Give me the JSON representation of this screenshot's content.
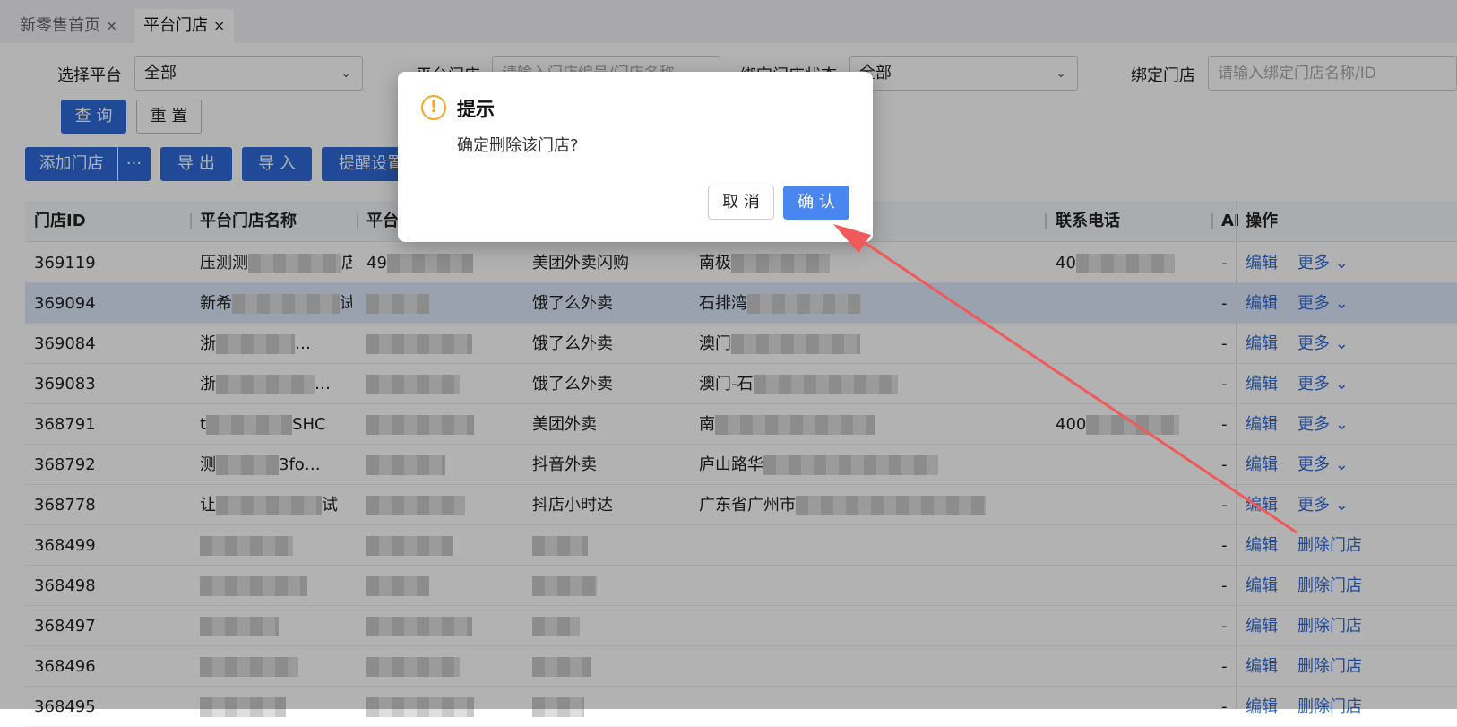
{
  "tabs": [
    {
      "label": "新零售首页",
      "close": "×"
    },
    {
      "label": "平台门店",
      "close": "×"
    }
  ],
  "filters": {
    "platform_label": "选择平台",
    "platform_value": "全部",
    "store_label": "平台门店",
    "store_placeholder": "请输入门店编号/门店名称",
    "bind_status_label": "绑定门店状态",
    "bind_status_value": "全部",
    "bind_store_label": "绑定门店",
    "bind_store_placeholder": "请输入绑定门店名称/ID"
  },
  "buttons": {
    "query": "查 询",
    "reset": "重 置",
    "add_store": "添加门店",
    "more": "···",
    "export": "导 出",
    "import": "导 入",
    "remind": "提醒设置"
  },
  "columns": {
    "store_id": "门店ID",
    "platform_store_name": "平台门店名称",
    "platform": "平台",
    "phone": "联系电话",
    "ai": "AI",
    "ops": "操作"
  },
  "rows": [
    {
      "id": "369119",
      "name": "压测测",
      "name_tail": "店_t_…",
      "pid": "49",
      "platform": "美团外卖闪购",
      "addr": "南极",
      "phone": "40",
      "ai": "-",
      "edit": "编辑",
      "action": "更多"
    },
    {
      "id": "369094",
      "name": "新希",
      "name_tail": "试…",
      "pid": "",
      "platform": "饿了么外卖",
      "addr": "石排湾",
      "phone": "",
      "ai": "-",
      "edit": "编辑",
      "action": "更多"
    },
    {
      "id": "369084",
      "name": "浙",
      "name_tail": "…",
      "pid": "",
      "platform": "饿了么外卖",
      "addr": "澳门",
      "phone": "",
      "ai": "-",
      "edit": "编辑",
      "action": "更多"
    },
    {
      "id": "369083",
      "name": "浙",
      "name_tail": "…",
      "pid": "",
      "platform": "饿了么外卖",
      "addr": "澳门-石",
      "phone": "",
      "ai": "-",
      "edit": "编辑",
      "action": "更多"
    },
    {
      "id": "368791",
      "name": "t",
      "name_tail": "SHC",
      "pid": "",
      "platform": "美团外卖",
      "addr": "南",
      "phone": "400",
      "ai": "-",
      "edit": "编辑",
      "action": "更多"
    },
    {
      "id": "368792",
      "name": "测",
      "name_tail": "3fo…",
      "pid": "",
      "platform": "抖音外卖",
      "addr": "庐山路华",
      "phone": "",
      "ai": "-",
      "edit": "编辑",
      "action": "更多"
    },
    {
      "id": "368778",
      "name": "让",
      "name_tail": "试",
      "pid": "",
      "platform": "抖店小时达",
      "addr": "广东省广州市",
      "phone": "",
      "ai": "-",
      "edit": "编辑",
      "action": "更多"
    },
    {
      "id": "368499",
      "name": "",
      "name_tail": "",
      "pid": "",
      "platform": "",
      "addr": "",
      "phone": "",
      "ai": "-",
      "edit": "编辑",
      "action": "删除门店"
    },
    {
      "id": "368498",
      "name": "",
      "name_tail": "",
      "pid": "",
      "platform": "",
      "addr": "",
      "phone": "",
      "ai": "-",
      "edit": "编辑",
      "action": "删除门店"
    },
    {
      "id": "368497",
      "name": "",
      "name_tail": "",
      "pid": "",
      "platform": "",
      "addr": "",
      "phone": "",
      "ai": "-",
      "edit": "编辑",
      "action": "删除门店"
    },
    {
      "id": "368496",
      "name": "",
      "name_tail": "",
      "pid": "",
      "platform": "",
      "addr": "",
      "phone": "",
      "ai": "-",
      "edit": "编辑",
      "action": "删除门店"
    },
    {
      "id": "368495",
      "name": "",
      "name_tail": "",
      "pid": "",
      "platform": "",
      "addr": "",
      "phone": "",
      "ai": "-",
      "edit": "编辑",
      "action": "删除门店"
    }
  ],
  "dialog": {
    "icon": "warning-icon",
    "icon_glyph": "!",
    "title": "提示",
    "message": "确定删除该门店?",
    "cancel": "取 消",
    "confirm": "确 认"
  },
  "colors": {
    "primary": "#2f6bd8",
    "confirm": "#4a86f0",
    "warning": "#f5a623",
    "arrow": "#f05a5a"
  }
}
